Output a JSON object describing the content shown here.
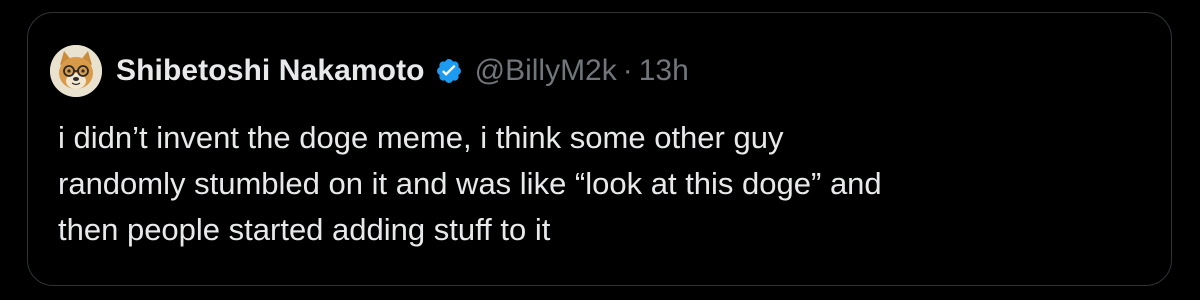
{
  "post": {
    "author": {
      "display_name": "Shibetoshi Nakamoto",
      "handle": "@BillyM2k",
      "avatar_icon": "doge-avatar-icon",
      "verified_icon": "verified-badge-icon",
      "verified_color": "#1d9bf0"
    },
    "separator": "·",
    "timestamp": "13h",
    "text_lines": [
      "i didn’t invent the doge meme, i think some other guy",
      "randomly stumbled on it and was like “look at this doge” and",
      "then people started adding stuff to it"
    ]
  },
  "colors": {
    "background": "#000000",
    "card_border": "#2f3336",
    "primary_text": "#e7e9ea",
    "secondary_text": "#71767b"
  }
}
